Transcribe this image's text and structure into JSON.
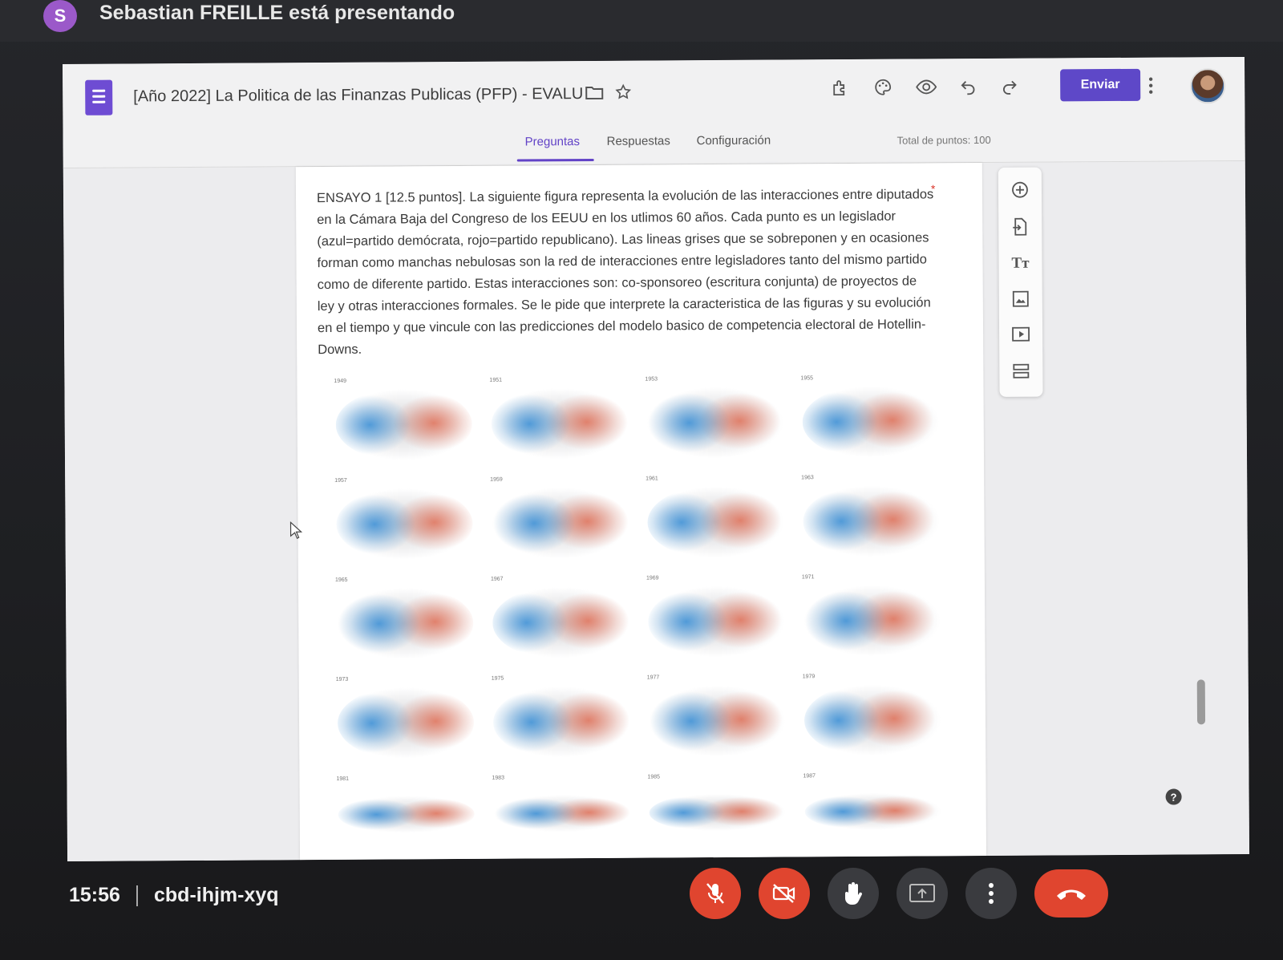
{
  "presenter": {
    "initial": "S",
    "text": "Sebastian FREILLE está presentando"
  },
  "form": {
    "title": "[Año 2022] La Politica de las Finanzas Publicas (PFP) - EVALU",
    "send_label": "Enviar",
    "tabs": [
      {
        "label": "Preguntas",
        "active": true
      },
      {
        "label": "Respuestas",
        "active": false
      },
      {
        "label": "Configuración",
        "active": false
      }
    ],
    "total_points": "Total de puntos: 100",
    "question": {
      "text": "ENSAYO 1 [12.5 puntos]. La siguiente figura representa la evolución de las interacciones entre diputados en la Cámara Baja del Congreso de los EEUU en los utlimos 60 años. Cada punto es un legislador (azul=partido demócrata, rojo=partido republicano). Las lineas grises que se sobreponen y en ocasiones forman como manchas nebulosas son la red de interacciones entre legisladores tanto del mismo partido como de diferente partido. Estas interacciones son: co-sponsoreo (escritura conjunta) de proyectos de ley y otras interacciones formales. Se le pide que interprete la caracteristica de las figuras y su evolución en el tiempo y que vincule con las predicciones del modelo basico de competencia electoral de Hotellin-Downs.",
      "required_mark": "*"
    },
    "figure_years": [
      "1949",
      "1951",
      "1953",
      "1955",
      "1957",
      "1959",
      "1961",
      "1963",
      "1965",
      "1967",
      "1969",
      "1971",
      "1973",
      "1975",
      "1977",
      "1979",
      "1981",
      "1983",
      "1985",
      "1987"
    ],
    "side_toolbar_icons": [
      "add-question-icon",
      "import-questions-icon",
      "title-text-icon",
      "image-icon",
      "video-icon",
      "section-icon"
    ],
    "colors": {
      "accent": "#6243c7",
      "send_button": "#5e48c8",
      "democrat": "#3a8fd6",
      "republican": "#e0694f",
      "meet_red": "#e0452f"
    }
  },
  "meet": {
    "time": "15:56",
    "meeting_code": "cbd-ihjm-xyq",
    "controls": [
      "mic-off-icon",
      "camera-off-icon",
      "raise-hand-icon",
      "present-icon",
      "more-options-icon",
      "hang-up-icon"
    ]
  }
}
